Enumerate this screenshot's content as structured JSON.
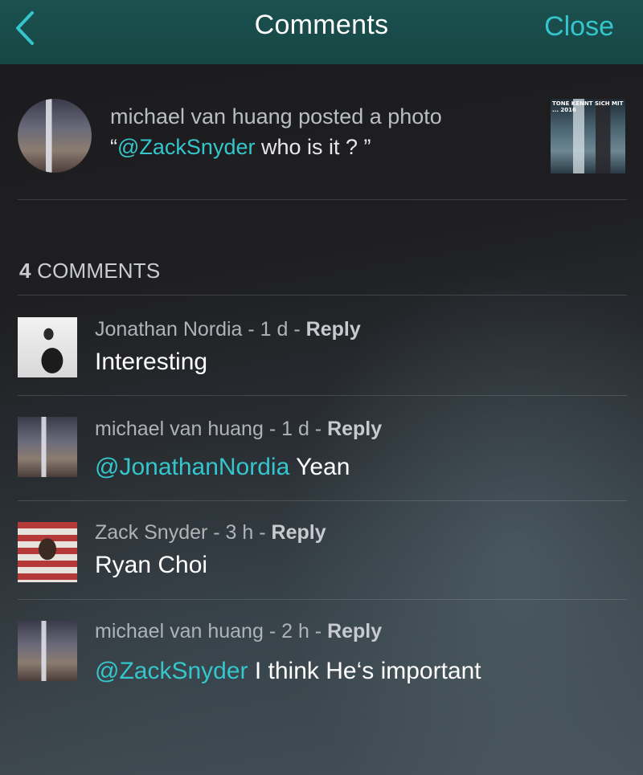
{
  "navbar": {
    "title": "Comments",
    "close_label": "Close",
    "back_icon": "chevron-left-icon"
  },
  "post": {
    "meta": "michael van huang posted a photo",
    "caption_open": "“",
    "caption_mention": "@ZackSnyder",
    "caption_rest": " who is it ? ”",
    "thumb_text_line1": "TONE KENNT SICH MIT",
    "thumb_text_line2": "... 2016"
  },
  "comments_header": {
    "count": "4",
    "label": "COMMENTS"
  },
  "comments": [
    {
      "author": "Jonathan Nordia",
      "time": " - 1 d - ",
      "reply": "Reply",
      "mention": "",
      "text": "Interesting"
    },
    {
      "author": "michael van huang",
      "time": " - 1 d - ",
      "reply": "Reply",
      "mention": "@JonathanNordia",
      "text": "  Yean"
    },
    {
      "author": "Zack Snyder",
      "time": " - 3 h - ",
      "reply": "Reply",
      "mention": "",
      "text": "Ryan Choi"
    },
    {
      "author": "michael van huang",
      "time": " - 2 h - ",
      "reply": "Reply",
      "mention": "@ZackSnyder",
      "text": " I think He‘s important"
    }
  ],
  "colors": {
    "accent": "#34c6cc",
    "navbar": "#174a48"
  }
}
